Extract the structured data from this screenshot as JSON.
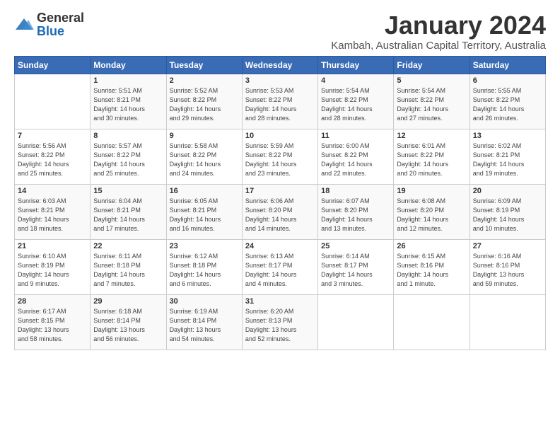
{
  "logo": {
    "general": "General",
    "blue": "Blue"
  },
  "title": "January 2024",
  "location": "Kambah, Australian Capital Territory, Australia",
  "days_of_week": [
    "Sunday",
    "Monday",
    "Tuesday",
    "Wednesday",
    "Thursday",
    "Friday",
    "Saturday"
  ],
  "weeks": [
    [
      {
        "day": "",
        "content": ""
      },
      {
        "day": "1",
        "content": "Sunrise: 5:51 AM\nSunset: 8:21 PM\nDaylight: 14 hours\nand 30 minutes."
      },
      {
        "day": "2",
        "content": "Sunrise: 5:52 AM\nSunset: 8:22 PM\nDaylight: 14 hours\nand 29 minutes."
      },
      {
        "day": "3",
        "content": "Sunrise: 5:53 AM\nSunset: 8:22 PM\nDaylight: 14 hours\nand 28 minutes."
      },
      {
        "day": "4",
        "content": "Sunrise: 5:54 AM\nSunset: 8:22 PM\nDaylight: 14 hours\nand 28 minutes."
      },
      {
        "day": "5",
        "content": "Sunrise: 5:54 AM\nSunset: 8:22 PM\nDaylight: 14 hours\nand 27 minutes."
      },
      {
        "day": "6",
        "content": "Sunrise: 5:55 AM\nSunset: 8:22 PM\nDaylight: 14 hours\nand 26 minutes."
      }
    ],
    [
      {
        "day": "7",
        "content": "Sunrise: 5:56 AM\nSunset: 8:22 PM\nDaylight: 14 hours\nand 25 minutes."
      },
      {
        "day": "8",
        "content": "Sunrise: 5:57 AM\nSunset: 8:22 PM\nDaylight: 14 hours\nand 25 minutes."
      },
      {
        "day": "9",
        "content": "Sunrise: 5:58 AM\nSunset: 8:22 PM\nDaylight: 14 hours\nand 24 minutes."
      },
      {
        "day": "10",
        "content": "Sunrise: 5:59 AM\nSunset: 8:22 PM\nDaylight: 14 hours\nand 23 minutes."
      },
      {
        "day": "11",
        "content": "Sunrise: 6:00 AM\nSunset: 8:22 PM\nDaylight: 14 hours\nand 22 minutes."
      },
      {
        "day": "12",
        "content": "Sunrise: 6:01 AM\nSunset: 8:22 PM\nDaylight: 14 hours\nand 20 minutes."
      },
      {
        "day": "13",
        "content": "Sunrise: 6:02 AM\nSunset: 8:21 PM\nDaylight: 14 hours\nand 19 minutes."
      }
    ],
    [
      {
        "day": "14",
        "content": "Sunrise: 6:03 AM\nSunset: 8:21 PM\nDaylight: 14 hours\nand 18 minutes."
      },
      {
        "day": "15",
        "content": "Sunrise: 6:04 AM\nSunset: 8:21 PM\nDaylight: 14 hours\nand 17 minutes."
      },
      {
        "day": "16",
        "content": "Sunrise: 6:05 AM\nSunset: 8:21 PM\nDaylight: 14 hours\nand 16 minutes."
      },
      {
        "day": "17",
        "content": "Sunrise: 6:06 AM\nSunset: 8:20 PM\nDaylight: 14 hours\nand 14 minutes."
      },
      {
        "day": "18",
        "content": "Sunrise: 6:07 AM\nSunset: 8:20 PM\nDaylight: 14 hours\nand 13 minutes."
      },
      {
        "day": "19",
        "content": "Sunrise: 6:08 AM\nSunset: 8:20 PM\nDaylight: 14 hours\nand 12 minutes."
      },
      {
        "day": "20",
        "content": "Sunrise: 6:09 AM\nSunset: 8:19 PM\nDaylight: 14 hours\nand 10 minutes."
      }
    ],
    [
      {
        "day": "21",
        "content": "Sunrise: 6:10 AM\nSunset: 8:19 PM\nDaylight: 14 hours\nand 9 minutes."
      },
      {
        "day": "22",
        "content": "Sunrise: 6:11 AM\nSunset: 8:18 PM\nDaylight: 14 hours\nand 7 minutes."
      },
      {
        "day": "23",
        "content": "Sunrise: 6:12 AM\nSunset: 8:18 PM\nDaylight: 14 hours\nand 6 minutes."
      },
      {
        "day": "24",
        "content": "Sunrise: 6:13 AM\nSunset: 8:17 PM\nDaylight: 14 hours\nand 4 minutes."
      },
      {
        "day": "25",
        "content": "Sunrise: 6:14 AM\nSunset: 8:17 PM\nDaylight: 14 hours\nand 3 minutes."
      },
      {
        "day": "26",
        "content": "Sunrise: 6:15 AM\nSunset: 8:16 PM\nDaylight: 14 hours\nand 1 minute."
      },
      {
        "day": "27",
        "content": "Sunrise: 6:16 AM\nSunset: 8:16 PM\nDaylight: 13 hours\nand 59 minutes."
      }
    ],
    [
      {
        "day": "28",
        "content": "Sunrise: 6:17 AM\nSunset: 8:15 PM\nDaylight: 13 hours\nand 58 minutes."
      },
      {
        "day": "29",
        "content": "Sunrise: 6:18 AM\nSunset: 8:14 PM\nDaylight: 13 hours\nand 56 minutes."
      },
      {
        "day": "30",
        "content": "Sunrise: 6:19 AM\nSunset: 8:14 PM\nDaylight: 13 hours\nand 54 minutes."
      },
      {
        "day": "31",
        "content": "Sunrise: 6:20 AM\nSunset: 8:13 PM\nDaylight: 13 hours\nand 52 minutes."
      },
      {
        "day": "",
        "content": ""
      },
      {
        "day": "",
        "content": ""
      },
      {
        "day": "",
        "content": ""
      }
    ]
  ]
}
